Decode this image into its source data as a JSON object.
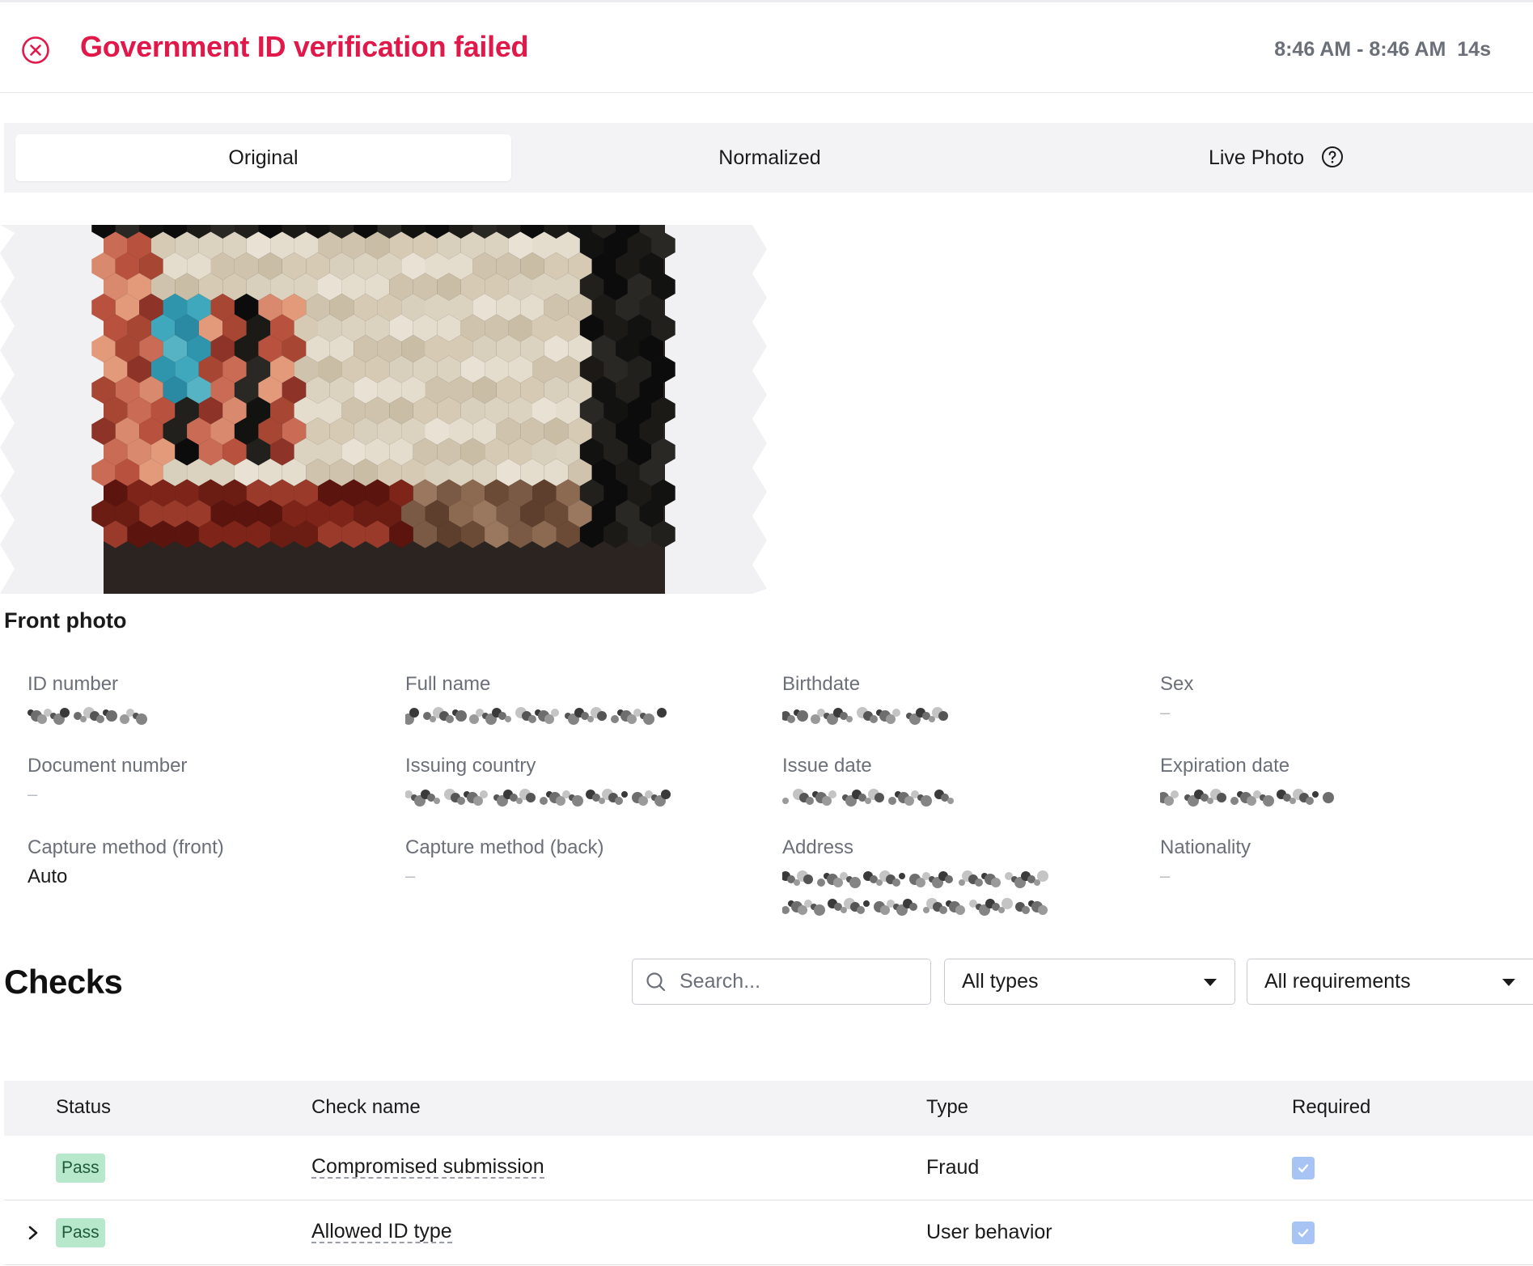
{
  "header": {
    "title": "Government ID verification failed",
    "time_range": "8:46 AM - 8:46 AM",
    "duration": "14s",
    "status_color": "#e0194a"
  },
  "tabs": [
    {
      "label": "Original",
      "active": true
    },
    {
      "label": "Normalized",
      "active": false
    },
    {
      "label": "Live Photo",
      "active": false,
      "icon": "help-circle-icon"
    }
  ],
  "photo": {
    "label": "Front photo"
  },
  "fields": {
    "id_number": {
      "label": "ID number"
    },
    "full_name": {
      "label": "Full name"
    },
    "birthdate": {
      "label": "Birthdate"
    },
    "sex": {
      "label": "Sex",
      "value": "–"
    },
    "document_number": {
      "label": "Document number",
      "value": "–"
    },
    "issuing_country": {
      "label": "Issuing country"
    },
    "issue_date": {
      "label": "Issue date"
    },
    "expiration_date": {
      "label": "Expiration date"
    },
    "capture_front": {
      "label": "Capture method (front)",
      "value": "Auto"
    },
    "capture_back": {
      "label": "Capture method (back)",
      "value": "–"
    },
    "address": {
      "label": "Address"
    },
    "nationality": {
      "label": "Nationality",
      "value": "–"
    }
  },
  "checks": {
    "title": "Checks",
    "search_placeholder": "Search...",
    "type_filter": "All types",
    "requirement_filter": "All requirements",
    "columns": {
      "status": "Status",
      "name": "Check name",
      "type": "Type",
      "required": "Required"
    },
    "rows": [
      {
        "status": "Pass",
        "name": "Compromised submission",
        "type": "Fraud",
        "required": true,
        "expandable": false
      },
      {
        "status": "Pass",
        "name": "Allowed ID type",
        "type": "User behavior",
        "required": true,
        "expandable": true
      }
    ]
  }
}
